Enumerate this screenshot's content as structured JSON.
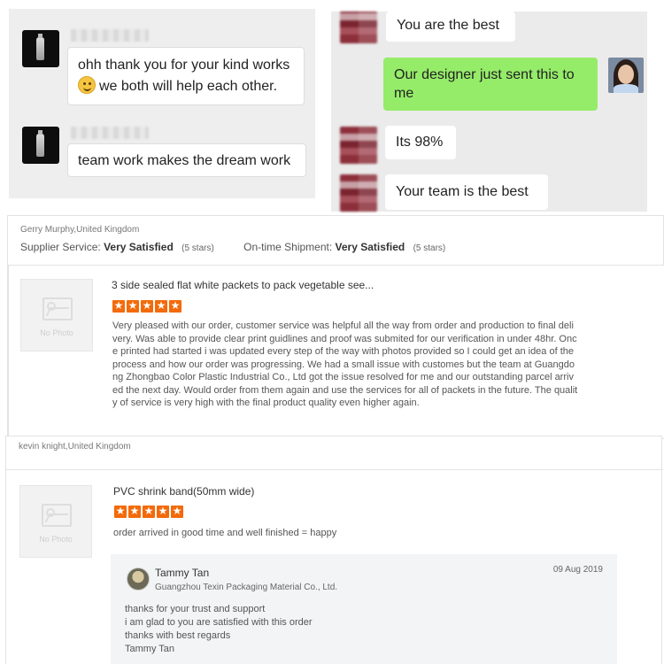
{
  "chat_left": {
    "messages": [
      {
        "avatar": "bottle-product-icon",
        "text_line1": "ohh thank you for your kind works",
        "text_line2": "we both will help each other.",
        "emoji": "smiley-emoji"
      },
      {
        "avatar": "bottle-product-icon",
        "text": "team work makes the dream work"
      }
    ]
  },
  "chat_right": {
    "messages": [
      {
        "from": "other",
        "text": "You are the best"
      },
      {
        "from": "self",
        "text_line1": "Our designer just sent this to",
        "text_line2": "me"
      },
      {
        "from": "other",
        "text": "Its 98%"
      },
      {
        "from": "other",
        "text": "Your team is the best"
      }
    ],
    "self_bubble_color": "#95ec69"
  },
  "reviews": [
    {
      "reviewer": "Gerry Murphy,United Kingdom",
      "supplier_service_label": "Supplier Service:",
      "supplier_service_value": "Very Satisfied",
      "supplier_service_stars": "(5 stars)",
      "shipment_label": "On-time Shipment:",
      "shipment_value": "Very Satisfied",
      "shipment_stars": "(5 stars)",
      "no_photo": "No Photo",
      "product": "3 side sealed flat white packets to pack vegetable see...",
      "rating": 5,
      "text": "Very pleased with our order, customer service was helpful all the way from order and production to final delivery. Was able to provide clear print guidlines and proof was submited for our verification in under 48hr. Once printed had started i was updated every step of the way with photos provided so I could get an idea of the process and how our order was progressing. We had a small issue with customes but the team at Guangdong Zhongbao Color Plastic Industrial Co., Ltd got the issue resolved for me and our outstanding parcel arrived the next day. Would order from them again and use the services for all of packets in the future. The quality of service is very high with the final product quality even higher again."
    },
    {
      "reviewer": "kevin knight,United Kingdom",
      "no_photo": "No Photo",
      "product": "PVC shrink band(50mm wide)",
      "rating": 5,
      "text": "order arrived in good time  and well finished = happy",
      "reply": {
        "name": "Tammy Tan",
        "company": "Guangzhou Texin Packaging Material Co., Ltd.",
        "date": "09 Aug 2019",
        "lines": [
          "thanks for your trust and support",
          "i am glad to you are satisfied with this order",
          "thanks with best regards",
          "Tammy Tan"
        ]
      }
    }
  ],
  "accent_star_color": "#f36a0a"
}
